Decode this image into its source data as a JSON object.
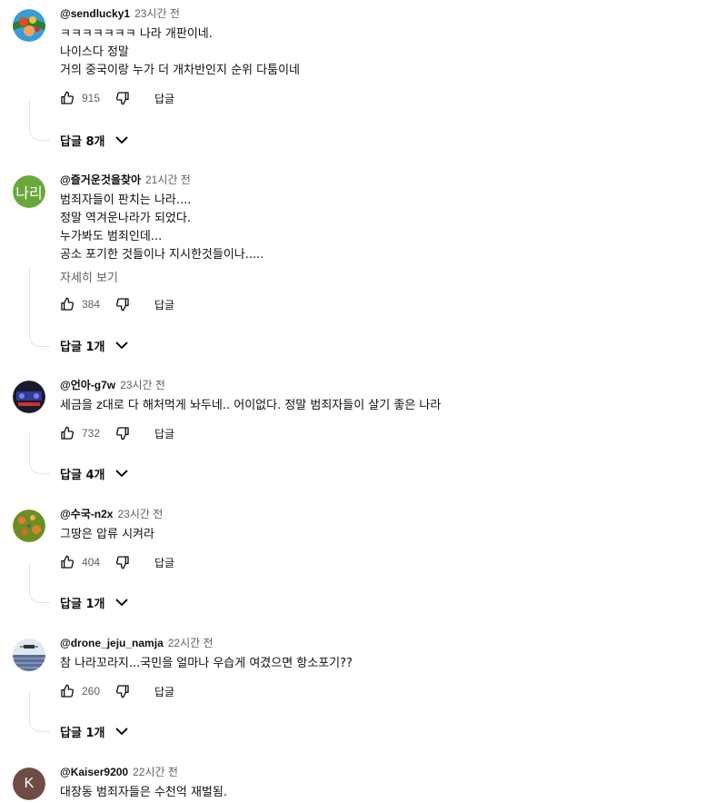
{
  "comments": [
    {
      "author": "@sendlucky1",
      "time": "23시간 전",
      "lines": [
        "ㅋㅋㅋㅋㅋㅋㅋ 나라 개판이네.",
        "나이스다 정말",
        "거의 중국이랑 누가 더 개차반인지 순위 다툼이네"
      ],
      "likes": "915",
      "reply_label": "답글",
      "replies_label": "답글 8개"
    },
    {
      "author": "@즐거운것을찾아",
      "time": "21시간 전",
      "avatar_text": "나리",
      "avatar_color": "#6aa83c",
      "lines": [
        "범죄자들이 판치는 나라....",
        "정말 역겨운나라가 되었다.",
        "누가봐도 범죄인데...",
        "공소 포기한 것들이나 지시한것들이나....."
      ],
      "more_label": "자세히 보기",
      "likes": "384",
      "reply_label": "답글",
      "replies_label": "답글 1개"
    },
    {
      "author": "@언아-g7w",
      "time": "23시간 전",
      "lines": [
        "세금을 z대로 다 해처먹게 놔두네.. 어이없다.  정말  범죄자들이 살기 좋은 나라"
      ],
      "likes": "732",
      "reply_label": "답글",
      "replies_label": "답글 4개"
    },
    {
      "author": "@수국-n2x",
      "time": "23시간 전",
      "lines": [
        "그땅은 압류 시켜라"
      ],
      "likes": "404",
      "reply_label": "답글",
      "replies_label": "답글 1개"
    },
    {
      "author": "@drone_jeju_namja",
      "time": "22시간 전",
      "lines": [
        "참 나라꼬라지...국민을 얼마나 우습게 여겼으면 항소포기??"
      ],
      "likes": "260",
      "reply_label": "답글",
      "replies_label": "답글 1개"
    },
    {
      "author": "@Kaiser9200",
      "time": "22시간 전",
      "avatar_text": "K",
      "avatar_color": "#6d4c41",
      "lines": [
        "대장동 범죄자들은 수천억 재벌됨."
      ]
    }
  ],
  "icons": {
    "like": "thumbs-up-icon",
    "dislike": "thumbs-down-icon",
    "expand": "chevron-down-icon"
  }
}
